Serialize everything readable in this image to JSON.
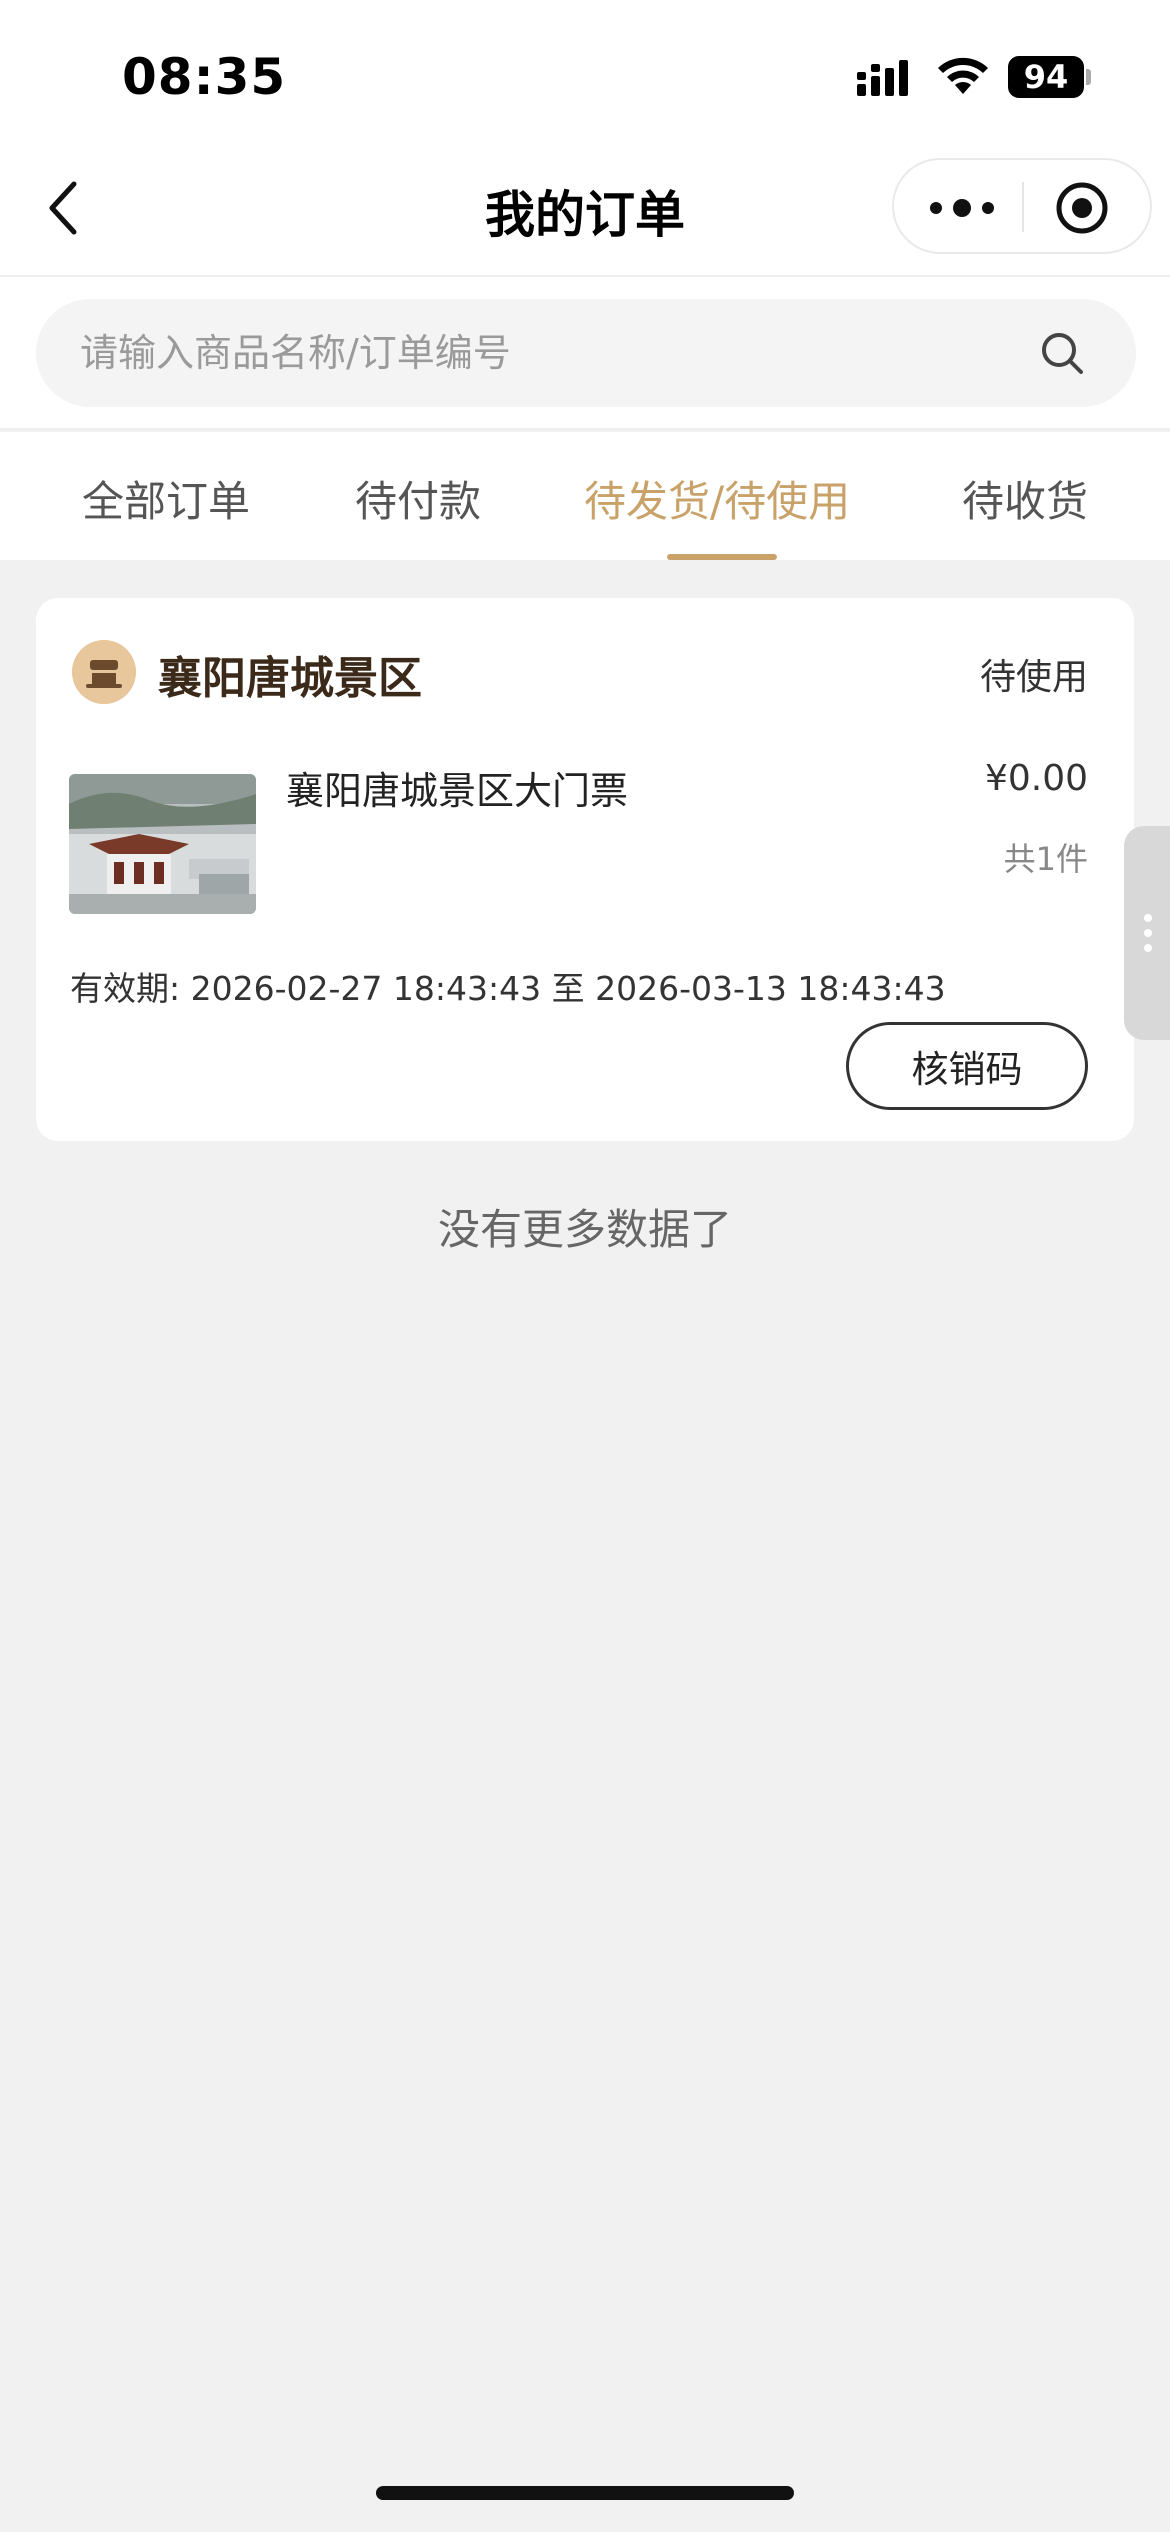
{
  "status_bar": {
    "time": "08:35",
    "battery_level": "94"
  },
  "navbar": {
    "title": "我的订单",
    "back_icon": "chevron-left-icon",
    "more_icon": "more-dots-icon",
    "close_icon": "target-close-icon"
  },
  "search": {
    "placeholder": "请输入商品名称/订单编号",
    "value": "",
    "icon": "search-icon"
  },
  "tabs": [
    {
      "label": "全部订单",
      "active": false
    },
    {
      "label": "待付款",
      "active": false
    },
    {
      "label": "待发货/待使用",
      "active": true
    },
    {
      "label": "待收货",
      "active": false
    }
  ],
  "order": {
    "shop_name": "襄阳唐城景区",
    "shop_icon": "store-icon",
    "status": "待使用",
    "product_name": "襄阳唐城景区大门票",
    "price": "¥0.00",
    "quantity": "共1件",
    "validity_label": "有效期:",
    "validity_start": "2026-02-27 18:43:43",
    "validity_sep": "至",
    "validity_end": "2026-03-13 18:43:43",
    "action_button": "核销码"
  },
  "footer_text": "没有更多数据了",
  "colors": {
    "accent": "#c9a26a",
    "background": "#f1f1f1",
    "card": "#ffffff",
    "shop_logo": "#e9c79c"
  }
}
